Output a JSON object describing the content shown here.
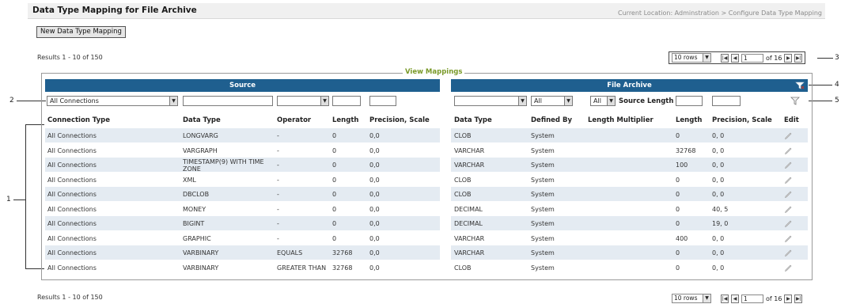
{
  "header": {
    "title": "Data Type Mapping for File Archive",
    "location": "Current Location: Adminstration > Configure Data Type Mapping"
  },
  "toolbar": {
    "new_button": "New Data Type Mapping"
  },
  "results": {
    "top": "Results 1 - 10 of 150",
    "bottom": "Results 1 - 10 of 150"
  },
  "pagination": {
    "rows_per_page": "10 rows",
    "first": "|◀",
    "prev": "◀",
    "page": "1",
    "of_pages": "of 16",
    "next": "▶",
    "last": "▶|"
  },
  "callouts": {
    "c1": "1",
    "c2": "2",
    "c3": "3",
    "c4": "4",
    "c5": "5"
  },
  "grid": {
    "group_label": "View Mappings",
    "source_band": "Source",
    "archive_band": "File Archive",
    "filters": {
      "connection": "All Connections",
      "data_type": "",
      "operator": "",
      "length": "",
      "precision": "",
      "arch_data_type": "",
      "defined_by": "All",
      "length_multiplier": "All",
      "source_length_label": "Source Length",
      "source_length": "",
      "arch_precision": ""
    },
    "columns": {
      "connection_type": "Connection Type",
      "data_type": "Data Type",
      "operator": "Operator",
      "length": "Length",
      "precision": "Precision, Scale",
      "arch_data_type": "Data Type",
      "defined_by": "Defined By",
      "length_multiplier": "Length Multiplier",
      "arch_length": "Length",
      "arch_precision": "Precision, Scale",
      "edit": "Edit"
    },
    "rows": [
      {
        "conn": "All Connections",
        "dtype": "LONGVARG",
        "op": "-",
        "len": "0",
        "prec": "0,0",
        "adtype": "CLOB",
        "def": "System",
        "alen": "0",
        "aprec": "0, 0"
      },
      {
        "conn": "All Connections",
        "dtype": "VARGRAPH",
        "op": "-",
        "len": "0",
        "prec": "0,0",
        "adtype": "VARCHAR",
        "def": "System",
        "alen": "32768",
        "aprec": "0, 0"
      },
      {
        "conn": "All Connections",
        "dtype": "TIMESTAMP(9) WITH TIME ZONE",
        "op": "-",
        "len": "0",
        "prec": "0,0",
        "adtype": "VARCHAR",
        "def": "System",
        "alen": "100",
        "aprec": "0, 0"
      },
      {
        "conn": "All Connections",
        "dtype": "XML",
        "op": "-",
        "len": "0",
        "prec": "0,0",
        "adtype": "CLOB",
        "def": "System",
        "alen": "0",
        "aprec": "0, 0"
      },
      {
        "conn": "All Connections",
        "dtype": "DBCLOB",
        "op": "-",
        "len": "0",
        "prec": "0,0",
        "adtype": "CLOB",
        "def": "System",
        "alen": "0",
        "aprec": "0, 0"
      },
      {
        "conn": "All Connections",
        "dtype": "MONEY",
        "op": "-",
        "len": "0",
        "prec": "0,0",
        "adtype": "DECIMAL",
        "def": "System",
        "alen": "0",
        "aprec": "40, 5"
      },
      {
        "conn": "All Connections",
        "dtype": "BIGINT",
        "op": "-",
        "len": "0",
        "prec": "0,0",
        "adtype": "DECIMAL",
        "def": "System",
        "alen": "0",
        "aprec": "19, 0"
      },
      {
        "conn": "All Connections",
        "dtype": "GRAPHIC",
        "op": "-",
        "len": "0",
        "prec": "0,0",
        "adtype": "VARCHAR",
        "def": "System",
        "alen": "400",
        "aprec": "0, 0"
      },
      {
        "conn": "All Connections",
        "dtype": "VARBINARY",
        "op": "EQUALS",
        "len": "32768",
        "prec": "0,0",
        "adtype": "VARCHAR",
        "def": "System",
        "alen": "0",
        "aprec": "0, 0"
      },
      {
        "conn": "All Connections",
        "dtype": "VARBINARY",
        "op": "GREATER THAN",
        "len": "32768",
        "prec": "0,0",
        "adtype": "CLOB",
        "def": "System",
        "alen": "0",
        "aprec": "0, 0"
      }
    ]
  },
  "icons": {
    "filter": "filter-icon",
    "clear_filter": "clear-filter-icon",
    "edit": "pencil-icon"
  },
  "colors": {
    "band": "#1f5f8f",
    "alt_row": "#e4ebf2",
    "group_label": "#7a9a2a"
  }
}
